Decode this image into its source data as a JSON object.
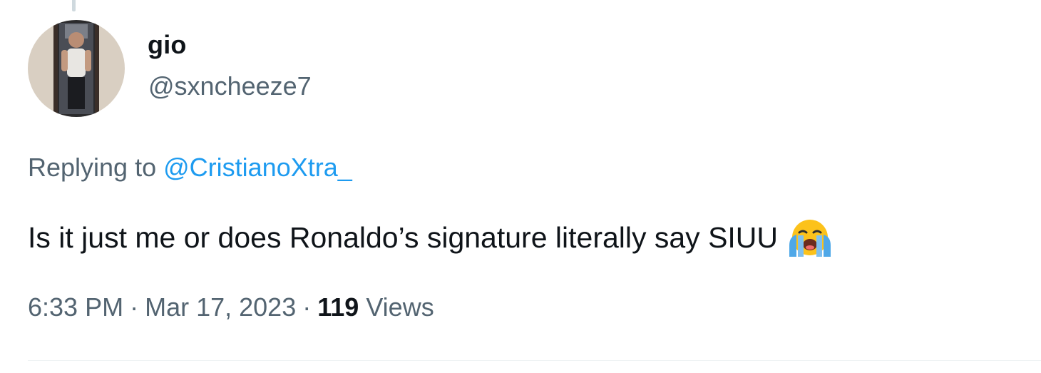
{
  "author": {
    "display_name": "gio",
    "handle": "@sxncheeze7",
    "avatar_icon": "user-avatar"
  },
  "reply": {
    "prefix": "Replying to",
    "mention": "@CristianoXtra_"
  },
  "tweet": {
    "text": "Is it just me or does Ronaldo’s signature literally say SIUU",
    "emoji": "loudly-crying-face-emoji"
  },
  "meta": {
    "time": "6:33 PM",
    "separator": "·",
    "date": "Mar 17, 2023",
    "views_count": "119",
    "views_label": "Views"
  },
  "colors": {
    "text_primary": "#0f1419",
    "text_secondary": "#536471",
    "link": "#1d9bf0",
    "divider": "#eff3f4"
  }
}
